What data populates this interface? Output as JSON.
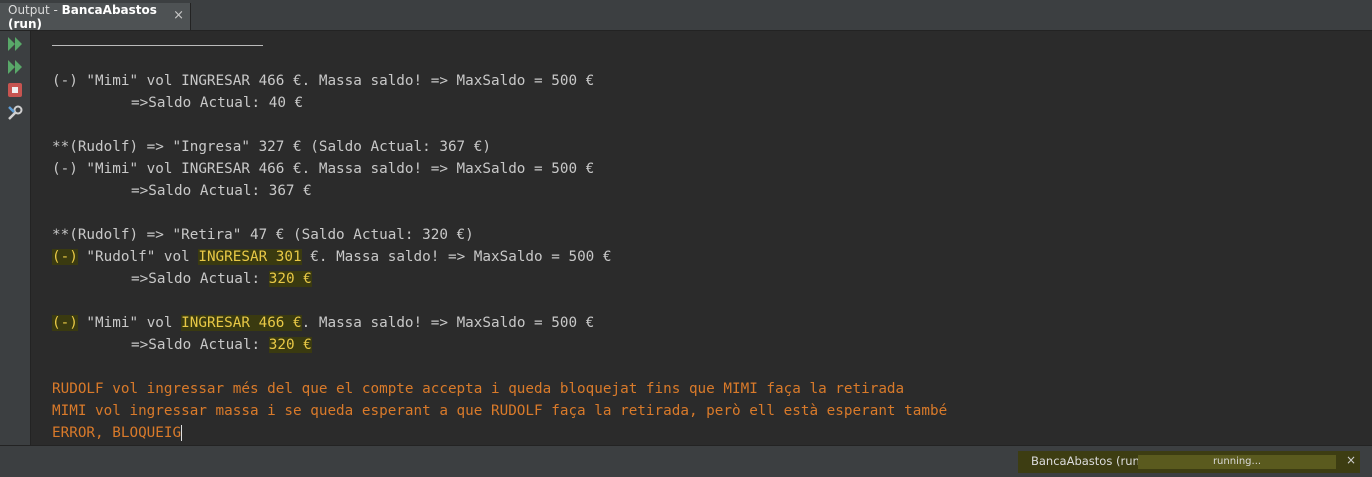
{
  "window": {
    "tab_prefix": "Output - ",
    "tab_name": "BancaAbastos (run)",
    "tab_close": "×"
  },
  "colors": {
    "background": "#2b2b2b",
    "text": "#c8c8c8",
    "highlight_bg": "#3a3a10",
    "highlight_text": "#e8c846",
    "error_text": "#d97a2a"
  },
  "toolbar": {
    "icons": [
      "rerun-icon",
      "rerun-debug-icon",
      "stop-icon",
      "settings-icon"
    ]
  },
  "console": {
    "lines": [
      {
        "text": "(-) \"Mimi\" vol INGRESAR 466 €. Massa saldo! => MaxSaldo = 500 €"
      },
      {
        "text": "=>Saldo Actual: 40 €"
      },
      {
        "text": "**(Rudolf) => \"Ingresa\" 327 € (Saldo Actual: 367 €)"
      },
      {
        "text": "(-) \"Mimi\" vol INGRESAR 466 €. Massa saldo! => MaxSaldo = 500 €"
      },
      {
        "text": "=>Saldo Actual: 367 €"
      },
      {
        "text": "**(Rudolf) => \"Retira\" 47 € (Saldo Actual: 320 €)"
      },
      {
        "p1": "(-)",
        "p2": " \"Rudolf\" vol ",
        "p3": "INGRESAR 301",
        "p4": " €. Massa saldo! => MaxSaldo = 500 €"
      },
      {
        "p1": "=>Saldo Actual: ",
        "p2": "320 €"
      },
      {
        "p1": "(-)",
        "p2": " \"Mimi\" vol ",
        "p3": "INGRESAR 466 €",
        "p4": ". Massa saldo! => MaxSaldo = 500 €"
      },
      {
        "p1": "=>Saldo Actual: ",
        "p2": "320 €"
      },
      {
        "text": "RUDOLF vol ingressar més del que el compte accepta i queda bloquejat fins que MIMI faça la retirada"
      },
      {
        "text": "MIMI vol ingressar massa i se queda esperant a que RUDOLF faça la retirada, però ell està esperant també"
      },
      {
        "text": "ERROR, BLOQUEIG"
      }
    ]
  },
  "status": {
    "task_name": "BancaAbastos (run)",
    "progress_label": "running...",
    "close": "×"
  }
}
